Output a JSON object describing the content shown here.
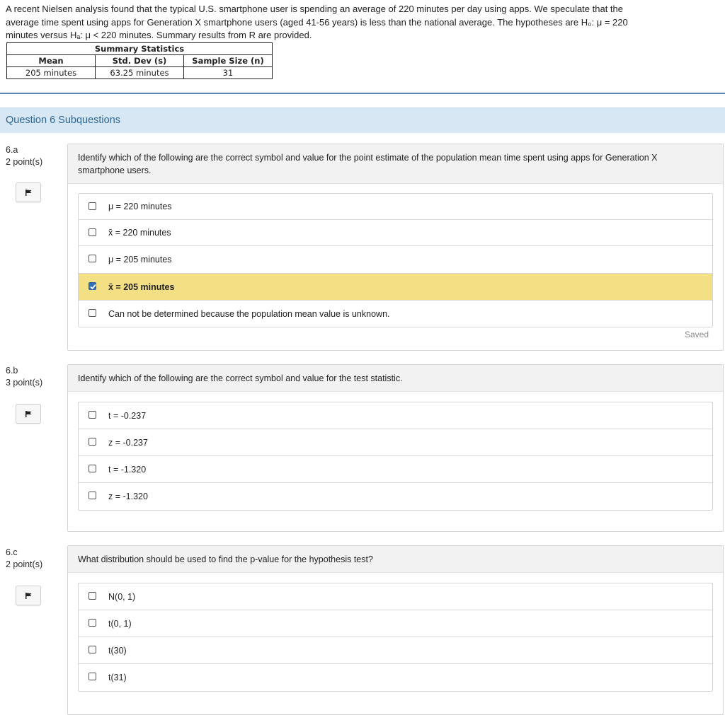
{
  "intro": {
    "line1": "A recent Nielsen analysis found that the typical U.S. smartphone user is spending an average of 220 minutes per day using apps.  We speculate that the",
    "line2": "average time spent using apps for Generation X smartphone users (aged 41-56 years) is less than the national average. The hypotheses are H₀: μ = 220",
    "line3": "minutes versus Hₐ: μ < 220 minutes. Summary results from R are provided."
  },
  "summary_table": {
    "caption": "Summary Statistics",
    "headers": [
      "Mean",
      "Std. Dev (s)",
      "Sample Size (n)"
    ],
    "values": [
      "205 minutes",
      "63.25 minutes",
      "31"
    ]
  },
  "subquestions_header": "Question 6 Subquestions",
  "questions": [
    {
      "number": "6.a",
      "points": "2 point(s)",
      "prompt": "Identify which of the following are the correct symbol and value for the point estimate of the population mean time spent using apps for Generation X smartphone users.",
      "options": [
        {
          "label": "μ = 220 minutes",
          "checked": false
        },
        {
          "label": "x̄ = 220 minutes",
          "checked": false
        },
        {
          "label": "μ = 205 minutes",
          "checked": false
        },
        {
          "label": "x̄ = 205 minutes",
          "checked": true
        },
        {
          "label": "Can not be determined because the population mean value is unknown.",
          "checked": false
        }
      ],
      "status": "Saved"
    },
    {
      "number": "6.b",
      "points": "3 point(s)",
      "prompt": "Identify which of the following are the correct symbol and value for the test statistic.",
      "options": [
        {
          "label": "t = -0.237",
          "checked": false
        },
        {
          "label": "z = -0.237",
          "checked": false
        },
        {
          "label": "t = -1.320",
          "checked": false
        },
        {
          "label": "z = -1.320",
          "checked": false
        }
      ]
    },
    {
      "number": "6.c",
      "points": "2 point(s)",
      "prompt": "What distribution should be used to find the p-value for the hypothesis test?",
      "options": [
        {
          "label": "N(0, 1)",
          "checked": false
        },
        {
          "label": "t(0, 1)",
          "checked": false
        },
        {
          "label": "t(30)",
          "checked": false
        },
        {
          "label": "t(31)",
          "checked": false
        }
      ]
    }
  ],
  "colors": {
    "header_bg": "#d7e7f4",
    "header_text": "#2d6694",
    "selected_bg": "#f3df84",
    "checkbox_checked": "#2f6fb8"
  }
}
